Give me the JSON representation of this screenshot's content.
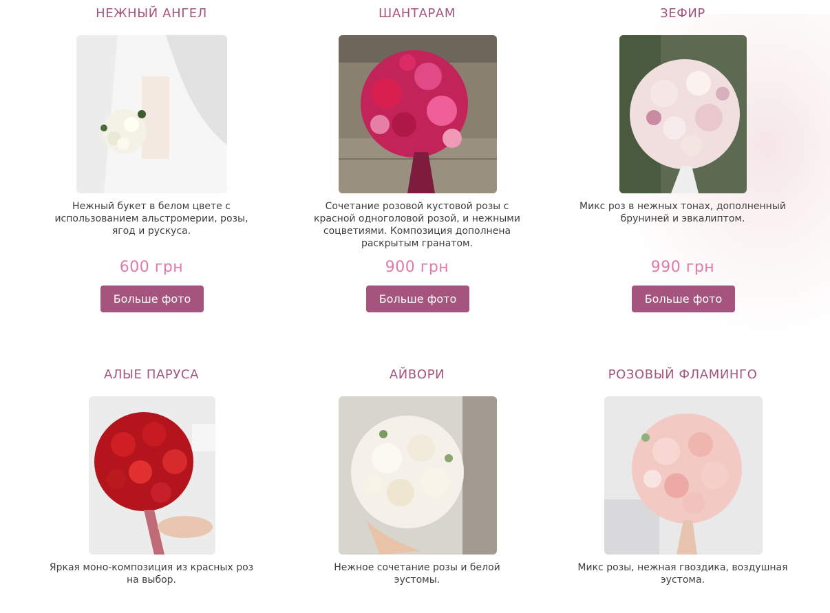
{
  "products": [
    {
      "title": "НЕЖНЫЙ АНГЕЛ",
      "description": "Нежный букет в белом цвете с использованием альстромерии, розы, ягод и рускуса.",
      "price": "600 грн",
      "button_label": "Больше фото"
    },
    {
      "title": "ШАНТАРАМ",
      "description": "Сочетание розовой кустовой розы с красной одноголовой розой, и нежными соцветиями. Композиция дополнена раскрытым гранатом.",
      "price": "900 грн",
      "button_label": "Больше фото"
    },
    {
      "title": "ЗЕФИР",
      "description": "Микс роз в нежных тонах, дополненный бруниней и эвкалиптом.",
      "price": "990 грн",
      "button_label": "Больше фото"
    },
    {
      "title": "АЛЫЕ ПАРУСА",
      "description": "Яркая моно-композиция из красных роз на выбор."
    },
    {
      "title": "АЙВОРИ",
      "description": "Нежное сочетание розы и белой эустомы."
    },
    {
      "title": "РОЗОВЫЙ ФЛАМИНГО",
      "description": "Микс розы, нежная гвоздика, воздушная эустома."
    }
  ],
  "colors": {
    "accent": "#a5547d",
    "price": "#e07aa6"
  }
}
